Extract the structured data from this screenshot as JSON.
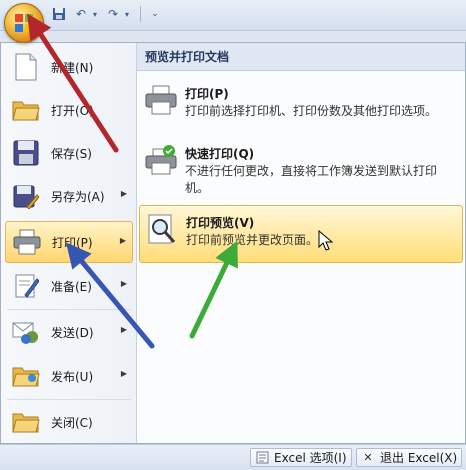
{
  "menu": {
    "left_items": [
      {
        "label": "新建(N)",
        "icon": "new-document-icon",
        "has_submenu": false
      },
      {
        "label": "打开(O)",
        "icon": "open-folder-icon",
        "has_submenu": false
      },
      {
        "label": "保存(S)",
        "icon": "save-disk-icon",
        "has_submenu": false
      },
      {
        "label": "另存为(A)",
        "icon": "save-as-icon",
        "has_submenu": true
      },
      {
        "label": "打印(P)",
        "icon": "printer-icon",
        "has_submenu": true,
        "active": true
      },
      {
        "label": "准备(E)",
        "icon": "prepare-icon",
        "has_submenu": true
      },
      {
        "label": "发送(D)",
        "icon": "send-icon",
        "has_submenu": true
      },
      {
        "label": "发布(U)",
        "icon": "publish-icon",
        "has_submenu": true
      },
      {
        "label": "关闭(C)",
        "icon": "close-folder-icon",
        "has_submenu": false
      }
    ],
    "panel": {
      "header": "预览并打印文档",
      "items": [
        {
          "title": "打印(P)",
          "desc": "打印前选择打印机、打印份数及其他打印选项。",
          "icon": "printer-icon"
        },
        {
          "title": "快速打印(Q)",
          "desc": "不进行任何更改，直接将工作簿发送到默认打印机。",
          "icon": "quick-print-icon"
        },
        {
          "title": "打印预览(V)",
          "desc": "打印前预览并更改页面。",
          "icon": "print-preview-icon",
          "active": true
        }
      ]
    }
  },
  "bottom": {
    "options_label": "Excel 选项(I)",
    "exit_label": "退出 Excel(X)"
  },
  "colors": {
    "highlight": "#ffd66f",
    "arrow_red": "#b3262b",
    "arrow_blue": "#3656b4",
    "arrow_green": "#3cab3a"
  }
}
